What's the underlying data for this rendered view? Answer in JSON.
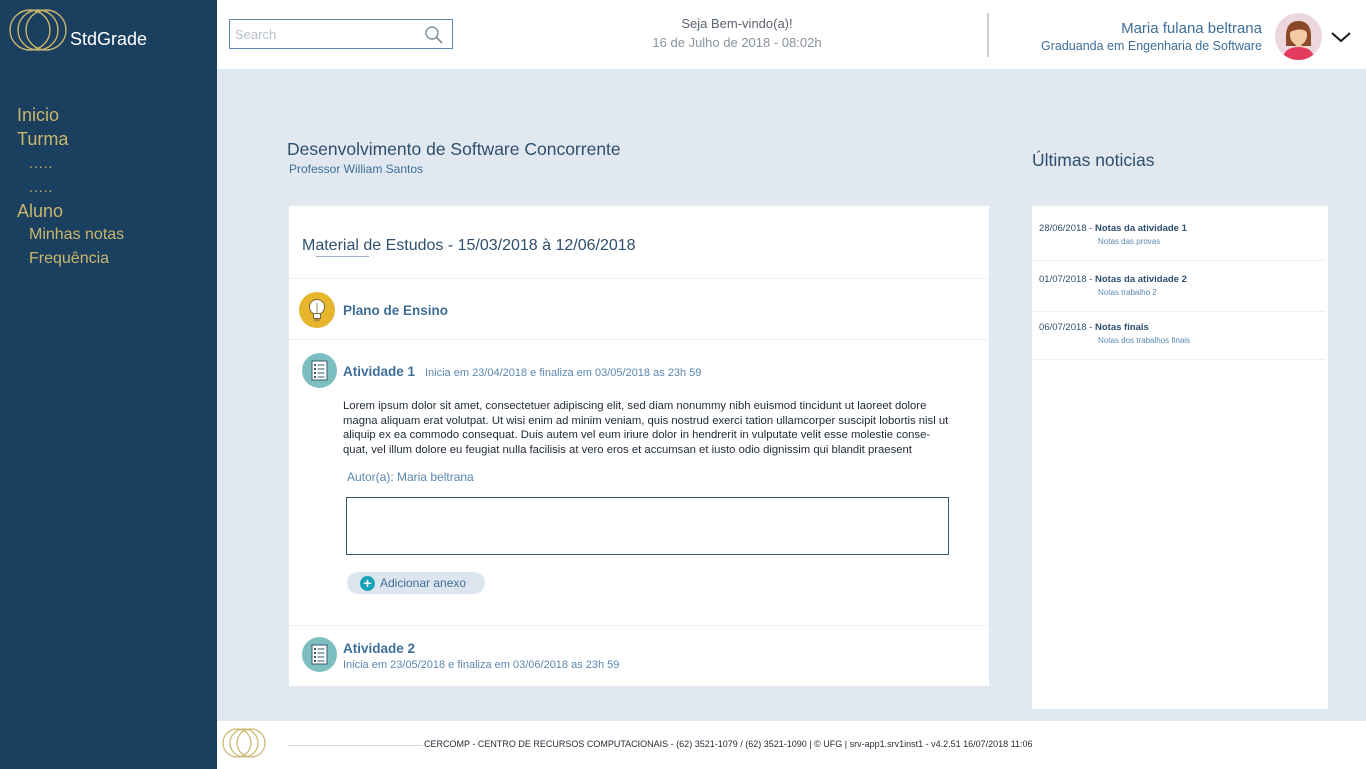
{
  "app": {
    "brand": "StdGrade"
  },
  "sidebar": {
    "items": [
      {
        "label": "Inicio"
      },
      {
        "label": "Turma"
      },
      {
        "label": "....."
      },
      {
        "label": "....."
      },
      {
        "label": "Aluno"
      },
      {
        "label": "Minhas notas"
      },
      {
        "label": "Frequência"
      }
    ]
  },
  "header": {
    "search_placeholder": "Search",
    "welcome": "Seja Bem-vindo(a)!",
    "datetime": "16 de Julho de 2018 - 08:02h",
    "user_name": "Maria fulana beltrana",
    "user_role": "Graduanda em Engenharia de Software"
  },
  "course": {
    "title": "Desenvolvimento de Software Concorrente",
    "professor": "Professor William Santos"
  },
  "material": {
    "title": "Material de Estudos - 15/03/2018 à 12/06/2018",
    "plan_label": "Plano de Ensino",
    "activity1": {
      "title": "Atividade 1",
      "dates": "Inicia em 23/04/2018 e finaliza em 03/05/2018 as 23h 59",
      "body": "Lorem ipsum dolor sit amet, consectetuer adipiscing elit, sed diam nonummy nibh euismod tincidunt ut laoreet dolore magna aliquam erat volutpat. Ut wisi enim ad minim veniam, quis nostrud exerci tation ullamcorper suscipit lobortis nisl ut aliquip ex ea commodo consequat. Duis autem vel eum iriure dolor in hendrerit in vulputate velit esse molestie conse-quat, vel illum dolore eu feugiat nulla facilisis at vero eros et accumsan et iusto odio dignissim qui blandit praesent",
      "author": "Autor(a): Maria beltrana",
      "attach_label": "Adicionar anexo"
    },
    "activity2": {
      "title": "Atividade 2",
      "dates": "Inicia em 23/05/2018 e finaliza em 03/06/2018 as 23h 59"
    }
  },
  "news": {
    "heading": "Últimas noticias",
    "items": [
      {
        "date": "28/06/2018 - ",
        "title": "Notas da atividade 1",
        "sub": "Notas das provas"
      },
      {
        "date": "01/07/2018 - ",
        "title": "Notas da atividade 2",
        "sub": "Notas trabalho 2"
      },
      {
        "date": "06/07/2018 - ",
        "title": "Notas finais",
        "sub": "Notas dos trabalhos finais"
      }
    ]
  },
  "footer": {
    "text": "CERCOMP - CENTRO DE RECURSOS COMPUTACIONAIS - (62) 3521-1079 / (62) 3521-1090 | © UFG | srv-app1.srv1inst1 - v4.2.51 16/07/2018 11:06"
  },
  "colors": {
    "sidebar_bg": "#1b3f5e",
    "nav_gold": "#c9b66e",
    "accent_blue": "#3d6e99",
    "page_bg": "#e1e8f0",
    "plan_icon": "#e6b52c",
    "activity_icon": "#7dbfc0",
    "attach_plus": "#1aa3b8"
  },
  "icons": [
    "rings-logo-icon",
    "search-icon",
    "avatar-icon",
    "chevron-down-icon",
    "lightbulb-icon",
    "checklist-icon",
    "plus-icon"
  ]
}
